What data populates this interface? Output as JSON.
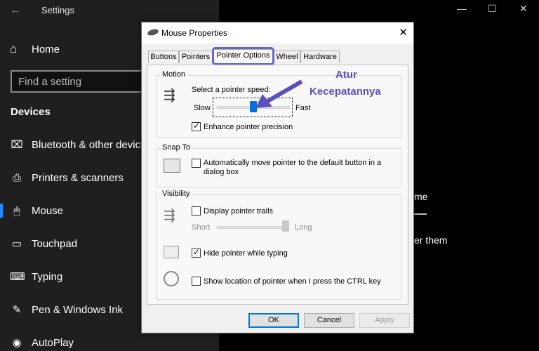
{
  "settings": {
    "title": "Settings",
    "home_label": "Home",
    "search_placeholder": "Find a setting",
    "section": "Devices",
    "nav": [
      {
        "label": "Bluetooth & other devices",
        "icon": "bluetooth-icon"
      },
      {
        "label": "Printers & scanners",
        "icon": "printer-icon"
      },
      {
        "label": "Mouse",
        "icon": "mouse-icon",
        "selected": true
      },
      {
        "label": "Touchpad",
        "icon": "touchpad-icon"
      },
      {
        "label": "Typing",
        "icon": "keyboard-icon"
      },
      {
        "label": "Pen & Windows Ink",
        "icon": "pen-icon"
      },
      {
        "label": "AutoPlay",
        "icon": "autoplay-icon"
      }
    ],
    "right_fragments": [
      "me",
      "er them"
    ],
    "accent": "#1a8cff"
  },
  "dialog": {
    "title": "Mouse Properties",
    "tabs": [
      "Buttons",
      "Pointers",
      "Pointer Options",
      "Wheel",
      "Hardware"
    ],
    "active_tab": "Pointer Options",
    "motion": {
      "title": "Motion",
      "speed_label": "Select a pointer speed:",
      "slow": "Slow",
      "fast": "Fast",
      "speed_value": 0.5,
      "precision_label": "Enhance pointer precision",
      "precision_checked": true
    },
    "snap": {
      "title": "Snap To",
      "label_line1": "Automatically move pointer to the default button in a",
      "label_line2": "dialog box",
      "checked": false
    },
    "visibility": {
      "title": "Visibility",
      "trails_label": "Display pointer trails",
      "trails_checked": false,
      "short": "Short",
      "long": "Long",
      "trail_value": 1.0,
      "hide_label": "Hide pointer while typing",
      "hide_checked": true,
      "ctrl_label": "Show location of pointer when I press the CTRL key",
      "ctrl_checked": false
    },
    "buttons": {
      "ok": "OK",
      "cancel": "Cancel",
      "apply": "Apply"
    }
  },
  "annotation": {
    "line1": "Atur",
    "line2": "Kecepatannya",
    "color": "#5a52b8"
  }
}
